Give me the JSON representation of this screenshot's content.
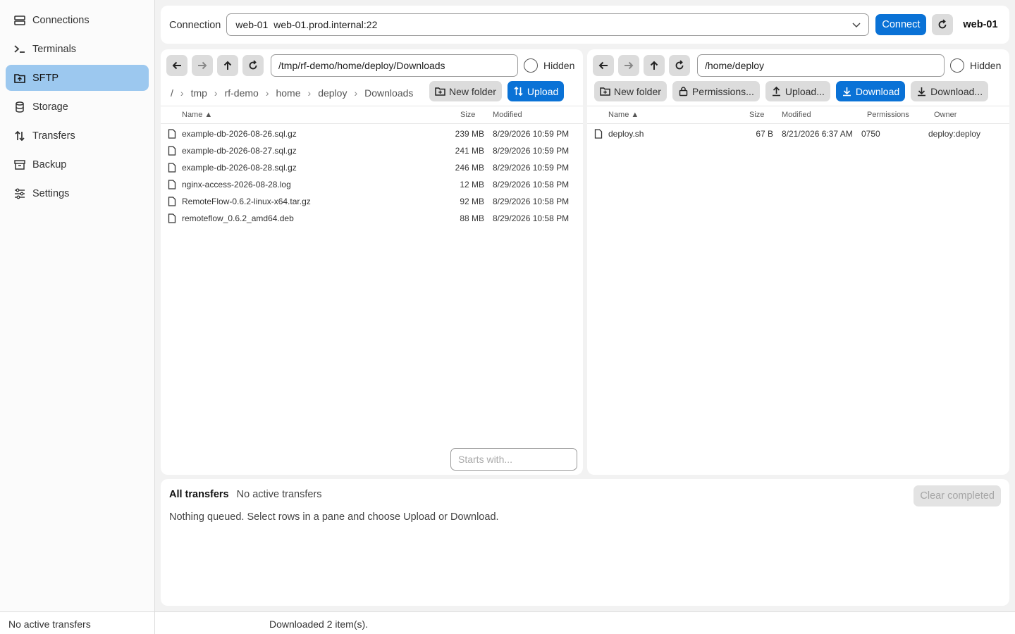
{
  "sidebar": {
    "items": [
      {
        "label": "Connections",
        "icon": "connections-icon",
        "active": false
      },
      {
        "label": "Terminals",
        "icon": "terminal-icon",
        "active": false
      },
      {
        "label": "SFTP",
        "icon": "sftp-folder-icon",
        "active": true
      },
      {
        "label": "Storage",
        "icon": "storage-icon",
        "active": false
      },
      {
        "label": "Transfers",
        "icon": "transfers-icon",
        "active": false
      },
      {
        "label": "Backup",
        "icon": "backup-icon",
        "active": false
      },
      {
        "label": "Settings",
        "icon": "settings-icon",
        "active": false
      }
    ]
  },
  "connection": {
    "label": "Connection",
    "selected_name": "web-01",
    "selected_host": "web-01.prod.internal:22",
    "connect_label": "Connect",
    "current_host": "web-01"
  },
  "left_pane": {
    "path": "/tmp/rf-demo/home/deploy/Downloads",
    "hidden_label": "Hidden",
    "breadcrumbs": [
      "/",
      "tmp",
      "rf-demo",
      "home",
      "deploy",
      "Downloads"
    ],
    "new_folder_label": "New folder",
    "upload_label": "Upload",
    "columns": {
      "name": "Name ▲",
      "size": "Size",
      "modified": "Modified"
    },
    "files": [
      {
        "name": "example-db-2026-08-26.sql.gz",
        "size": "239 MB",
        "modified": "8/29/2026 10:59 PM"
      },
      {
        "name": "example-db-2026-08-27.sql.gz",
        "size": "241 MB",
        "modified": "8/29/2026 10:59 PM"
      },
      {
        "name": "example-db-2026-08-28.sql.gz",
        "size": "246 MB",
        "modified": "8/29/2026 10:59 PM"
      },
      {
        "name": "nginx-access-2026-08-28.log",
        "size": "12 MB",
        "modified": "8/29/2026 10:58 PM"
      },
      {
        "name": "RemoteFlow-0.6.2-linux-x64.tar.gz",
        "size": "92 MB",
        "modified": "8/29/2026 10:58 PM"
      },
      {
        "name": "remoteflow_0.6.2_amd64.deb",
        "size": "88 MB",
        "modified": "8/29/2026 10:58 PM"
      }
    ],
    "filter_placeholder": "Starts with..."
  },
  "right_pane": {
    "path": "/home/deploy",
    "hidden_label": "Hidden",
    "new_folder_label": "New folder",
    "permissions_label": "Permissions...",
    "upload_label": "Upload...",
    "download_label": "Download",
    "download_to_label": "Download...",
    "columns": {
      "name": "Name ▲",
      "size": "Size",
      "modified": "Modified",
      "permissions": "Permissions",
      "owner": "Owner"
    },
    "files": [
      {
        "name": "deploy.sh",
        "size": "67 B",
        "modified": "8/21/2026 6:37 AM",
        "permissions": "0750",
        "owner": "deploy:deploy"
      }
    ]
  },
  "transfers": {
    "title": "All transfers",
    "status": "No active transfers",
    "clear_label": "Clear completed",
    "empty_message": "Nothing queued. Select rows in a pane and choose Upload or Download."
  },
  "statusbar": {
    "left": "No active transfers",
    "message": "Downloaded 2 item(s)."
  },
  "colors": {
    "accent": "#0a72d6",
    "active_nav": "#9cc8ef"
  }
}
